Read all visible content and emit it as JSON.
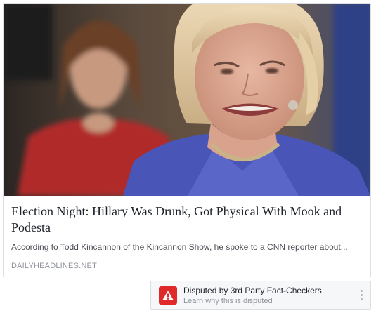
{
  "story": {
    "image_alt": "Hillary Clinton photo",
    "headline": "Election Night: Hillary Was Drunk, Got Physical With Mook and Podesta",
    "snippet": "According to Todd Kincannon of the Kincannon Show, he spoke to a CNN reporter about...",
    "domain": "DAILYHEADLINES.NET"
  },
  "dispute": {
    "title": "Disputed by 3rd Party Fact-Checkers",
    "subtitle": "Learn why this is disputed",
    "icon": "warning-icon",
    "more_icon": "more-vertical-icon"
  },
  "colors": {
    "warning": "#e02a2a",
    "domain_text": "#90949c",
    "headline_text": "#1d2129"
  }
}
